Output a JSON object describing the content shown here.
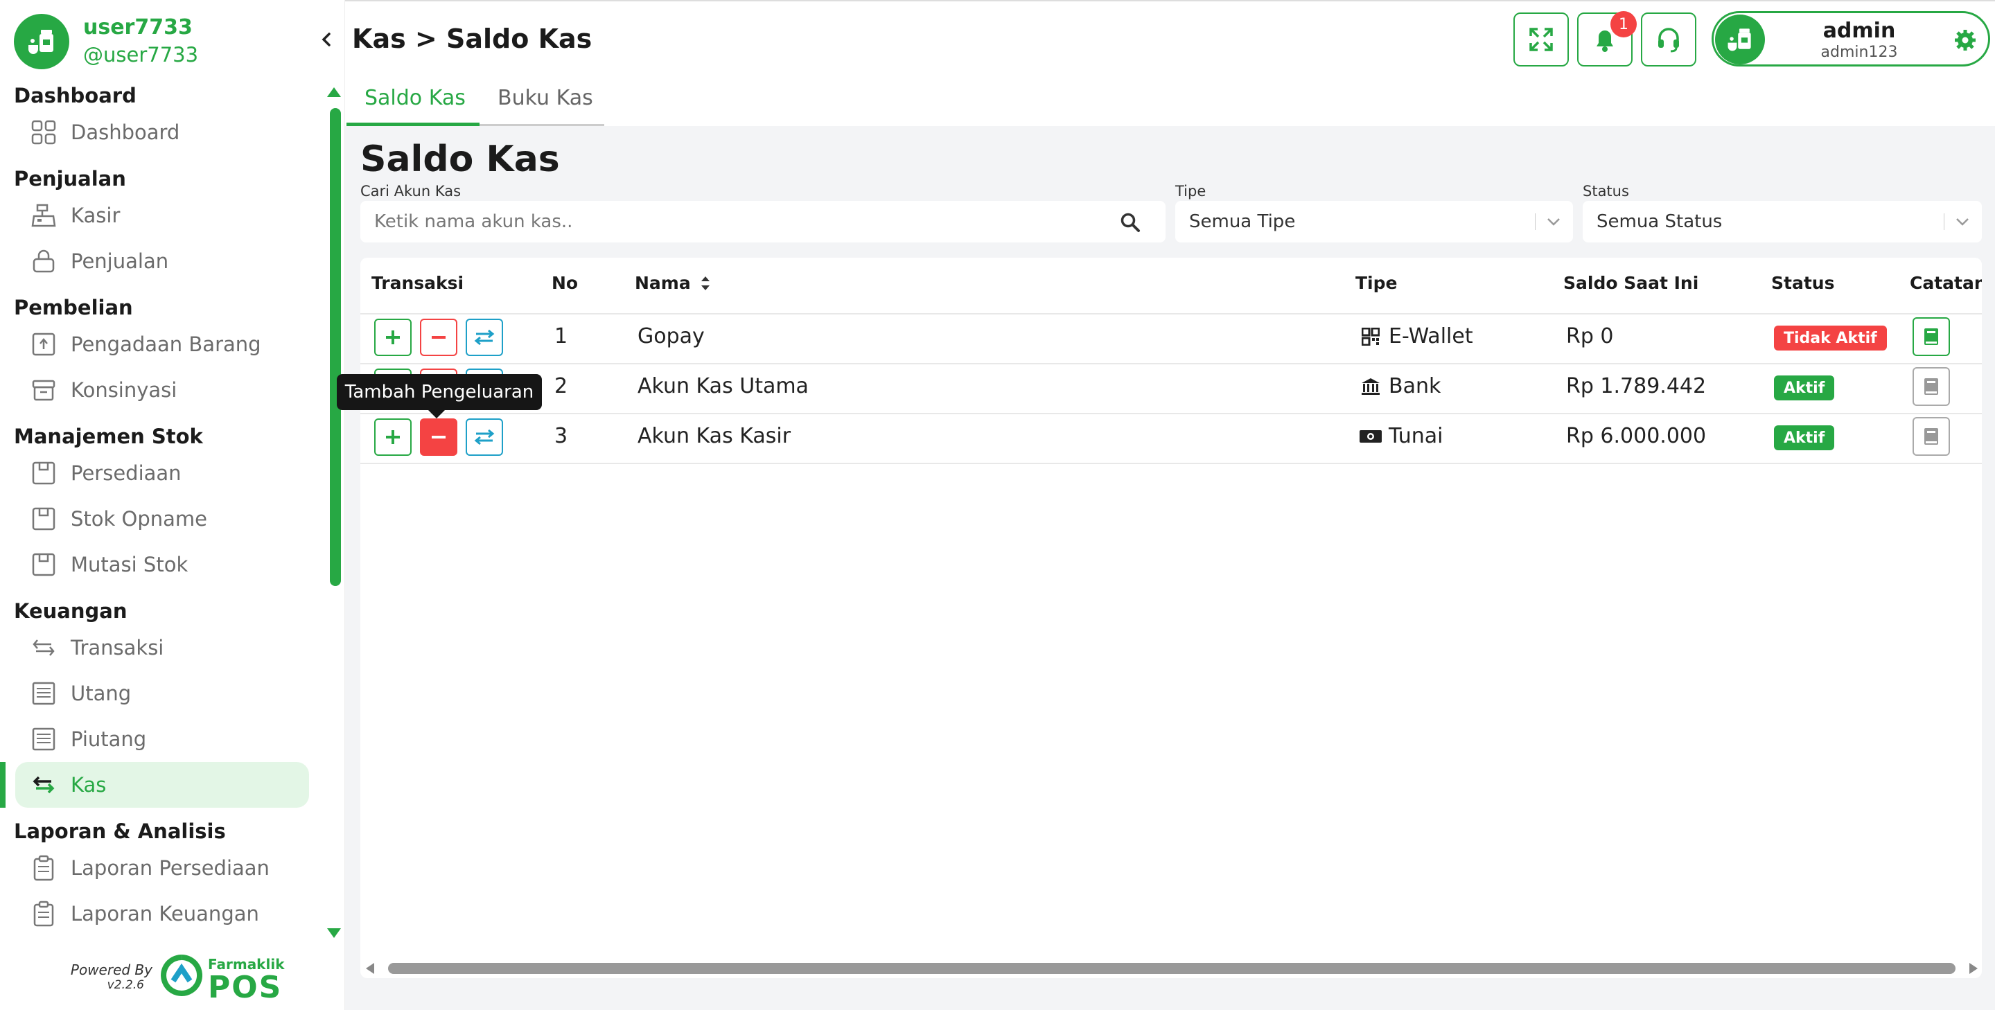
{
  "sidebar": {
    "user_name": "user7733",
    "user_handle": "@user7733",
    "sections": [
      {
        "title": "Dashboard",
        "items": [
          {
            "label": "Dashboard",
            "icon": "grid-icon"
          }
        ]
      },
      {
        "title": "Penjualan",
        "items": [
          {
            "label": "Kasir",
            "icon": "cash-register-icon"
          },
          {
            "label": "Penjualan",
            "icon": "shopping-basket-icon"
          }
        ]
      },
      {
        "title": "Pembelian",
        "items": [
          {
            "label": "Pengadaan Barang",
            "icon": "upload-box-icon"
          },
          {
            "label": "Konsinyasi",
            "icon": "archive-icon"
          }
        ]
      },
      {
        "title": "Manajemen Stok",
        "items": [
          {
            "label": "Persediaan",
            "icon": "box-icon"
          },
          {
            "label": "Stok Opname",
            "icon": "box-icon"
          },
          {
            "label": "Mutasi Stok",
            "icon": "box-icon"
          }
        ]
      },
      {
        "title": "Keuangan",
        "items": [
          {
            "label": "Transaksi",
            "icon": "swap-icon"
          },
          {
            "label": "Utang",
            "icon": "receipt-icon"
          },
          {
            "label": "Piutang",
            "icon": "receipt-icon"
          },
          {
            "label": "Kas",
            "icon": "swap-icon",
            "active": true
          }
        ]
      },
      {
        "title": "Laporan & Analisis",
        "items": [
          {
            "label": "Laporan Persediaan",
            "icon": "clipboard-icon"
          },
          {
            "label": "Laporan Keuangan",
            "icon": "clipboard-icon"
          }
        ]
      }
    ],
    "powered_by": "Powered By",
    "version": "v2.2.6",
    "logo_small": "Farmaklik",
    "logo_big": "POS"
  },
  "header": {
    "breadcrumb": "Kas > Saldo Kas",
    "notification_count": "1",
    "profile_name": "admin",
    "profile_sub": "admin123"
  },
  "tabs": [
    {
      "label": "Saldo Kas",
      "active": true
    },
    {
      "label": "Buku Kas",
      "active": false
    }
  ],
  "page_title": "Saldo Kas",
  "filters": {
    "search_label": "Cari Akun Kas",
    "search_placeholder": "Ketik nama akun kas..",
    "tipe_label": "Tipe",
    "tipe_value": "Semua Tipe",
    "status_label": "Status",
    "status_value": "Semua Status"
  },
  "table": {
    "headers": [
      "Transaksi",
      "No",
      "Nama",
      "Tipe",
      "Saldo Saat Ini",
      "Status",
      "Catatan"
    ],
    "rows": [
      {
        "no": "1",
        "nama": "Gopay",
        "tipe": "E-Wallet",
        "tipe_icon": "qr-code-icon",
        "saldo": "Rp 0",
        "status": "Tidak Aktif",
        "status_color": "#f44343"
      },
      {
        "no": "2",
        "nama": "Akun Kas Utama",
        "tipe": "Bank",
        "tipe_icon": "bank-icon",
        "saldo": "Rp 1.789.442",
        "status": "Aktif",
        "status_color": "#27a844"
      },
      {
        "no": "3",
        "nama": "Akun Kas Kasir",
        "tipe": "Tunai",
        "tipe_icon": "cash-icon",
        "saldo": "Rp 6.000.000",
        "status": "Aktif",
        "status_color": "#27a844"
      }
    ]
  },
  "tooltip": "Tambah Pengeluaran",
  "colors": {
    "accent": "#27a844",
    "danger": "#f44343",
    "transfer": "#1ea0c8"
  }
}
